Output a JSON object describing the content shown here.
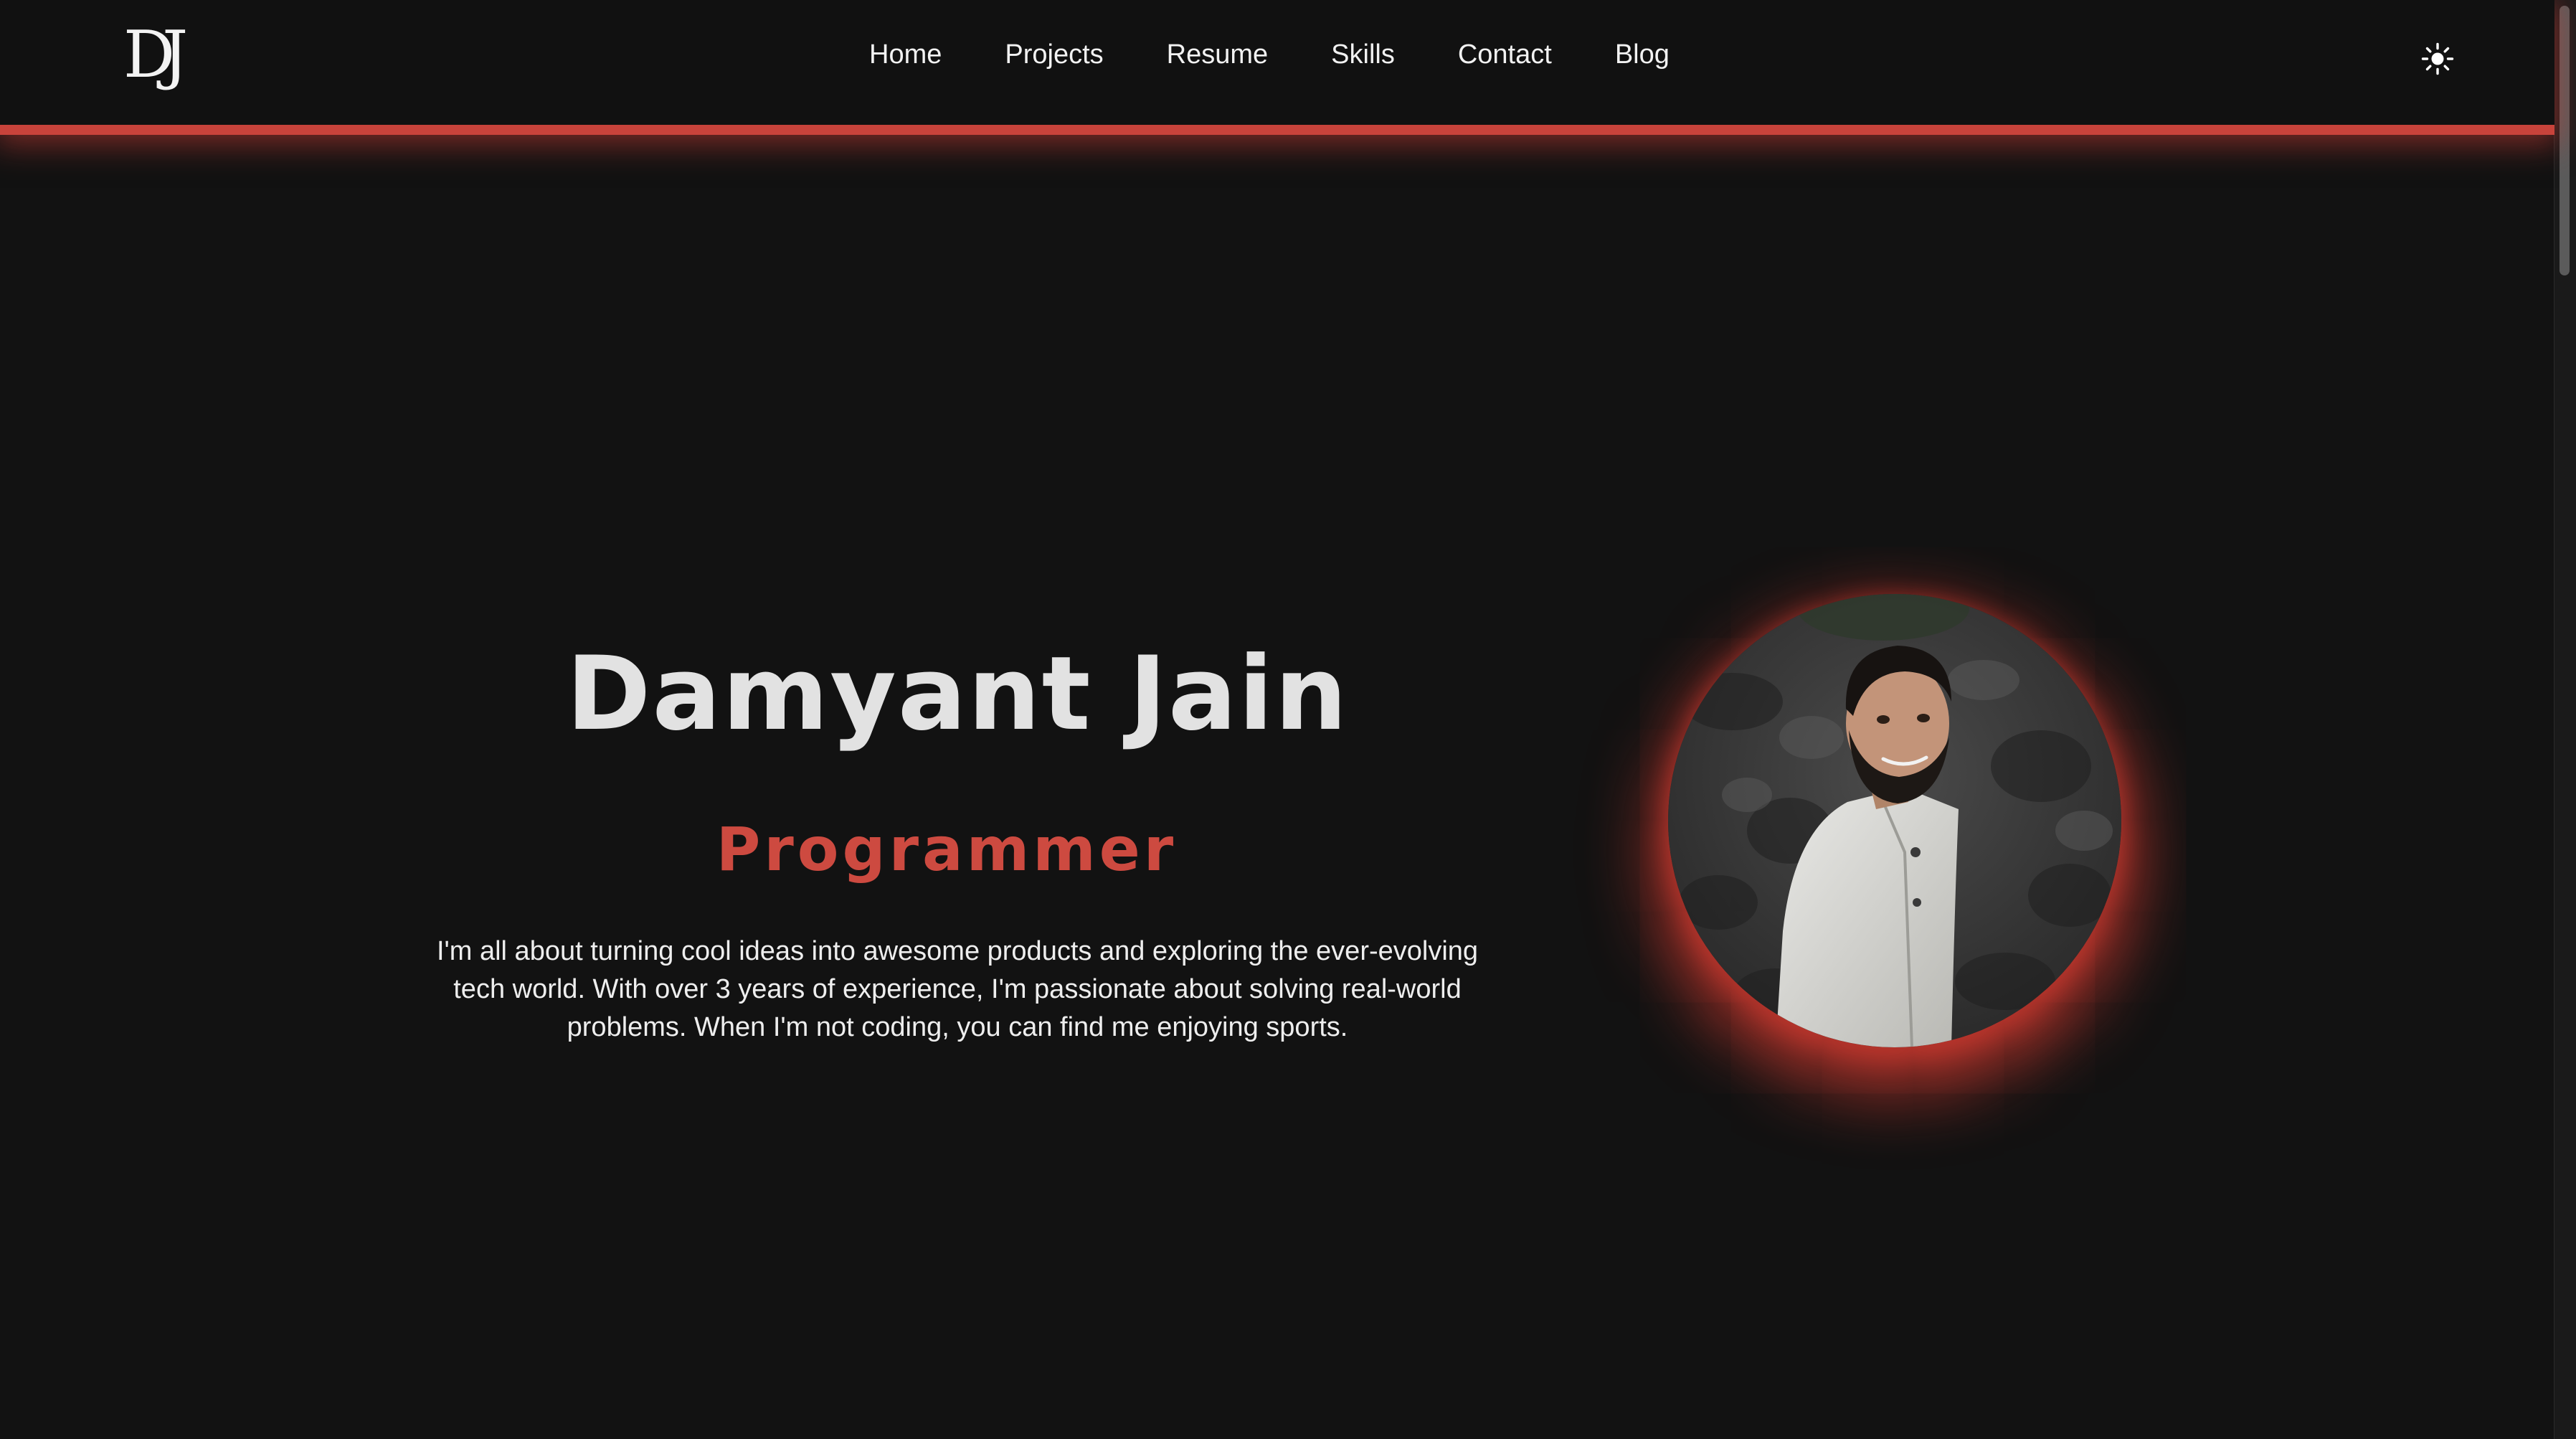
{
  "header": {
    "logo_text": "DJ",
    "nav": [
      {
        "label": "Home"
      },
      {
        "label": "Projects"
      },
      {
        "label": "Resume"
      },
      {
        "label": "Skills"
      },
      {
        "label": "Contact"
      },
      {
        "label": "Blog"
      }
    ],
    "theme_toggle_icon": "sun-icon"
  },
  "hero": {
    "name": "Damyant Jain",
    "role": "Programmer",
    "bio": "I'm all about turning cool ideas into awesome products and exploring the ever-evolving tech world. With over 3 years of experience, I'm passionate about solving real-world problems. When I'm not coding, you can find me enjoying sports.",
    "avatar_icon": "profile-photo"
  },
  "colors": {
    "background": "#121212",
    "accent": "#cd4a40",
    "text": "#e2e2e2"
  }
}
